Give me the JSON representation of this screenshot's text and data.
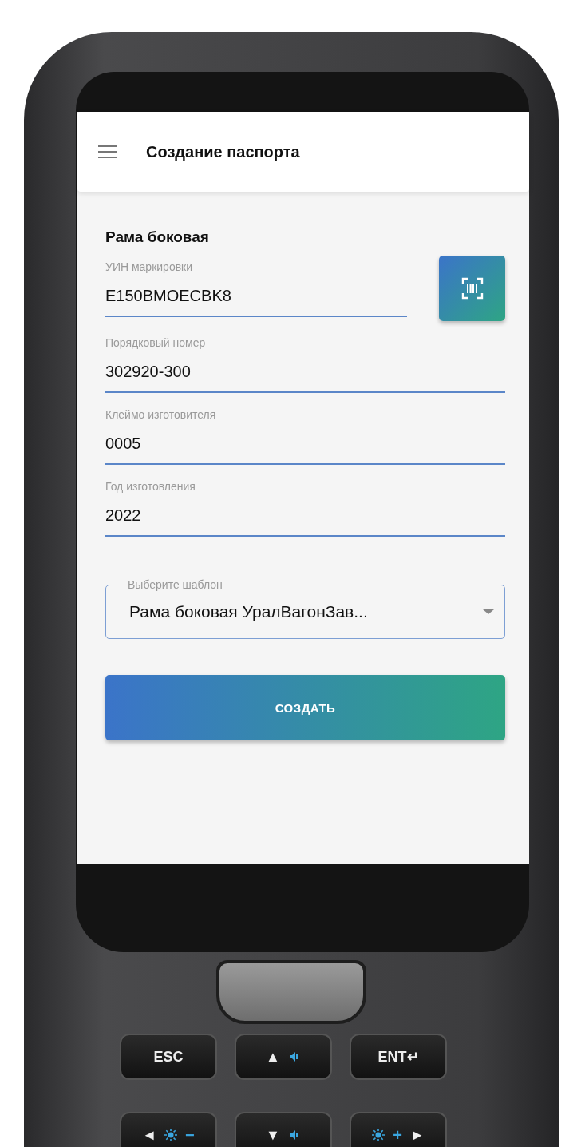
{
  "header": {
    "title": "Создание паспорта"
  },
  "form": {
    "section_title": "Рама боковая",
    "fields": [
      {
        "label": "УИН маркировки",
        "value": "E150BMOECBK8",
        "scan_button": true
      },
      {
        "label": "Порядковый номер",
        "value": "302920-300",
        "scan_button": false
      },
      {
        "label": "Клеймо изготовителя",
        "value": "0005",
        "scan_button": false
      },
      {
        "label": "Год изготовления",
        "value": "2022",
        "scan_button": false
      }
    ],
    "select": {
      "label": "Выберите шаблон",
      "value": "Рама боковая УралВагонЗав..."
    },
    "submit": "СОЗДАТЬ"
  },
  "keypad": {
    "rows": [
      [
        {
          "parts": [
            {
              "kind": "text",
              "text": "ESC"
            }
          ]
        },
        {
          "parts": [
            {
              "kind": "text",
              "text": "▲"
            },
            {
              "kind": "speaker"
            }
          ]
        },
        {
          "parts": [
            {
              "kind": "text",
              "text": "ENT↵"
            }
          ]
        }
      ],
      [
        {
          "parts": [
            {
              "kind": "text",
              "text": "◄"
            },
            {
              "kind": "sun"
            },
            {
              "kind": "accent",
              "text": "−"
            }
          ]
        },
        {
          "parts": [
            {
              "kind": "text",
              "text": "▼"
            },
            {
              "kind": "speaker"
            }
          ]
        },
        {
          "parts": [
            {
              "kind": "sun"
            },
            {
              "kind": "accent",
              "text": "+"
            },
            {
              "kind": "text",
              "text": "►"
            }
          ]
        }
      ]
    ]
  }
}
